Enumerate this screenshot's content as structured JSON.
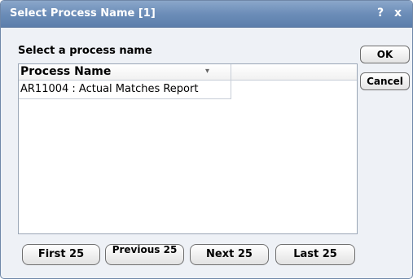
{
  "dialog": {
    "title": "Select Process Name [1]",
    "help_label": "?",
    "close_label": "x",
    "prompt": "Select a process name"
  },
  "list": {
    "column_header": "Process Name",
    "sort_icon": "▾",
    "rows": [
      "AR11004 : Actual Matches Report"
    ]
  },
  "buttons": {
    "ok": "OK",
    "cancel": "Cancel"
  },
  "pager": {
    "first": "First 25",
    "previous": "Previous 25",
    "next": "Next 25",
    "last": "Last 25"
  }
}
